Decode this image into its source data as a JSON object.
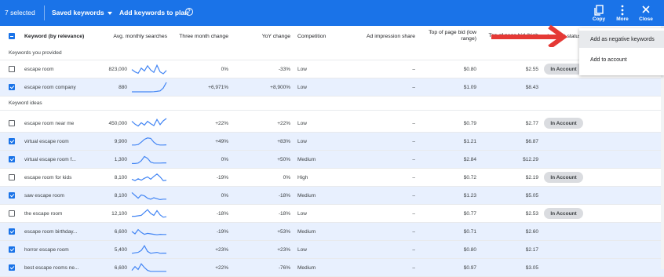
{
  "toolbar": {
    "selected_label": "7 selected",
    "saved_keywords_label": "Saved keywords",
    "add_to_plan_label": "Add keywords to plan",
    "help_glyph": "?",
    "copy_label": "Copy",
    "more_label": "More",
    "close_label": "Close"
  },
  "columns": {
    "keyword": "Keyword (by relevance)",
    "avg": "Avg. monthly searches",
    "three_month": "Three month change",
    "yoy": "YoY change",
    "competition": "Competition",
    "ad_impr": "Ad impression share",
    "bid_low": "Top of page bid (low range)",
    "bid_high": "Top of page bid (high",
    "status": "Account status"
  },
  "sections": {
    "provided": "Keywords you provided",
    "ideas": "Keyword ideas"
  },
  "rows": [
    {
      "keyword": "escape room",
      "avg": "823,000",
      "three": "0%",
      "yoy": "-33%",
      "comp": "Low",
      "impr": "–",
      "low": "$0.80",
      "high": "$2.55",
      "status": "In Account",
      "checked": false,
      "spark": [
        0.45,
        0.2,
        0.05,
        0.6,
        0.3,
        0.85,
        0.4,
        0.15,
        0.9,
        0.2,
        0.0,
        0.35
      ]
    },
    {
      "keyword": "escape room company",
      "avg": "880",
      "three": "+6,971%",
      "yoy": "+8,900%",
      "comp": "Low",
      "impr": "–",
      "low": "$1.09",
      "high": "$8.43",
      "status": "",
      "checked": true,
      "spark": [
        0.0,
        0.0,
        0.0,
        0.0,
        0.0,
        0.0,
        0.0,
        0.02,
        0.05,
        0.1,
        0.4,
        1.0
      ]
    },
    {
      "keyword": "escape room near me",
      "avg": "450,000",
      "three": "+22%",
      "yoy": "+22%",
      "comp": "Low",
      "impr": "–",
      "low": "$0.79",
      "high": "$2.77",
      "status": "In Account",
      "checked": false,
      "spark": [
        0.7,
        0.4,
        0.2,
        0.55,
        0.3,
        0.7,
        0.45,
        0.25,
        0.9,
        0.35,
        0.75,
        1.0
      ]
    },
    {
      "keyword": "virtual escape room",
      "avg": "9,900",
      "three": "+49%",
      "yoy": "+83%",
      "comp": "Low",
      "impr": "–",
      "low": "$1.21",
      "high": "$6.87",
      "status": "",
      "checked": true,
      "spark": [
        0.1,
        0.1,
        0.15,
        0.4,
        0.7,
        0.85,
        0.8,
        0.4,
        0.15,
        0.1,
        0.1,
        0.12
      ]
    },
    {
      "keyword": "virtual escape room f...",
      "avg": "1,300",
      "three": "0%",
      "yoy": "+50%",
      "comp": "Medium",
      "impr": "–",
      "low": "$2.84",
      "high": "$12.29",
      "status": "",
      "checked": true,
      "spark": [
        0.05,
        0.05,
        0.1,
        0.35,
        0.8,
        0.6,
        0.2,
        0.1,
        0.1,
        0.1,
        0.12,
        0.12
      ]
    },
    {
      "keyword": "escape room for kids",
      "avg": "8,100",
      "three": "-19%",
      "yoy": "0%",
      "comp": "High",
      "impr": "–",
      "low": "$0.72",
      "high": "$2.19",
      "status": "In Account",
      "checked": false,
      "spark": [
        0.3,
        0.15,
        0.35,
        0.2,
        0.4,
        0.55,
        0.3,
        0.6,
        0.85,
        0.55,
        0.15,
        0.2
      ]
    },
    {
      "keyword": "saw escape room",
      "avg": "8,100",
      "three": "0%",
      "yoy": "-18%",
      "comp": "Medium",
      "impr": "–",
      "low": "$1.23",
      "high": "$5.05",
      "status": "",
      "checked": true,
      "spark": [
        0.8,
        0.5,
        0.2,
        0.55,
        0.45,
        0.2,
        0.1,
        0.25,
        0.15,
        0.05,
        0.1,
        0.1
      ]
    },
    {
      "keyword": "the escape room",
      "avg": "12,100",
      "three": "-18%",
      "yoy": "-18%",
      "comp": "Low",
      "impr": "–",
      "low": "$0.77",
      "high": "$2.53",
      "status": "In Account",
      "checked": false,
      "spark": [
        0.2,
        0.2,
        0.25,
        0.3,
        0.6,
        0.9,
        0.5,
        0.3,
        0.8,
        0.35,
        0.1,
        0.15
      ]
    },
    {
      "keyword": "escape room birthday...",
      "avg": "6,600",
      "three": "-19%",
      "yoy": "+53%",
      "comp": "Medium",
      "impr": "–",
      "low": "$0.71",
      "high": "$2.60",
      "status": "",
      "checked": true,
      "spark": [
        0.5,
        0.25,
        0.7,
        0.4,
        0.2,
        0.3,
        0.25,
        0.2,
        0.15,
        0.2,
        0.18,
        0.18
      ]
    },
    {
      "keyword": "horror escape room",
      "avg": "5,400",
      "three": "+23%",
      "yoy": "+23%",
      "comp": "Low",
      "impr": "–",
      "low": "$0.80",
      "high": "$2.17",
      "status": "",
      "checked": true,
      "spark": [
        0.1,
        0.15,
        0.2,
        0.4,
        0.9,
        0.3,
        0.1,
        0.15,
        0.2,
        0.1,
        0.12,
        0.12
      ]
    },
    {
      "keyword": "best escape rooms ne...",
      "avg": "6,600",
      "three": "+22%",
      "yoy": "-76%",
      "comp": "Medium",
      "impr": "–",
      "low": "$0.97",
      "high": "$3.05",
      "status": "",
      "checked": true,
      "spark": [
        0.2,
        0.6,
        0.3,
        0.9,
        0.5,
        0.2,
        0.1,
        0.1,
        0.1,
        0.1,
        0.1,
        0.1
      ]
    }
  ],
  "menu": {
    "items": [
      "Add as negative keywords",
      "Add to account"
    ]
  },
  "colors": {
    "brand_blue": "#1a73e8",
    "spark_line": "#4285f4",
    "selected_row": "#e8f0fe",
    "annotation_arrow": "#e53935"
  },
  "icons": {
    "copy": "copy-icon",
    "more": "more-vert-icon",
    "close": "close-icon",
    "help": "help-icon",
    "dropdown": "caret-down-icon"
  }
}
